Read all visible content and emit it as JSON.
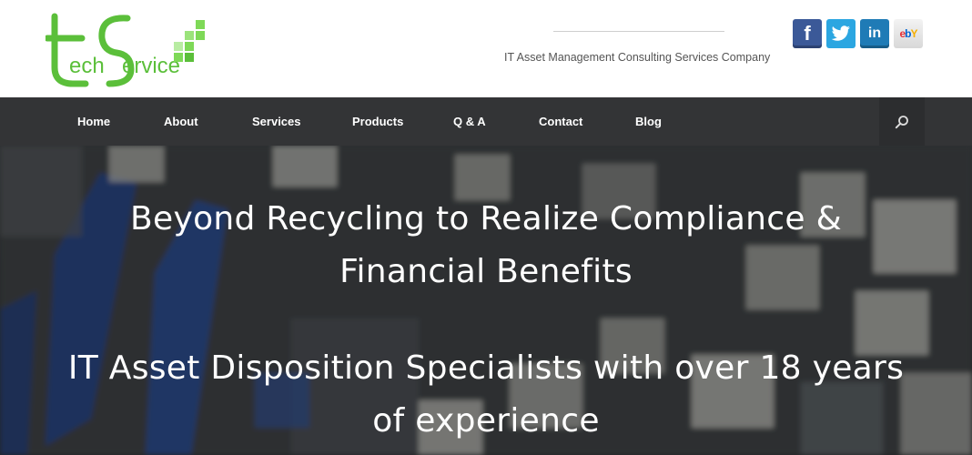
{
  "header": {
    "logo_text_tech": "ech",
    "logo_text_service": "ervice",
    "tagline": "IT Asset Management Consulting Services Company",
    "social": [
      {
        "name": "facebook",
        "icon": "facebook-icon",
        "color": "#3b5998"
      },
      {
        "name": "twitter",
        "icon": "twitter-icon",
        "color": "#2ba6e1"
      },
      {
        "name": "linkedin",
        "icon": "linkedin-icon",
        "color": "#1f7bb6"
      },
      {
        "name": "ebay",
        "icon": "ebay-icon",
        "color": "#e53238"
      }
    ]
  },
  "nav": {
    "items": [
      {
        "label": "Home"
      },
      {
        "label": "About"
      },
      {
        "label": "Services"
      },
      {
        "label": "Products"
      },
      {
        "label": "Q & A"
      },
      {
        "label": "Contact"
      },
      {
        "label": "Blog"
      }
    ],
    "search_icon": "search-icon",
    "background": "#333436"
  },
  "hero": {
    "headline_line1": "Beyond Recycling to Realize Compliance &",
    "headline_line2": "Financial Benefits",
    "subheadline_line1": "IT Asset Disposition Specialists with over 18 years",
    "subheadline_line2": "of experience"
  },
  "brand": {
    "accent": "#5bbf3a"
  }
}
